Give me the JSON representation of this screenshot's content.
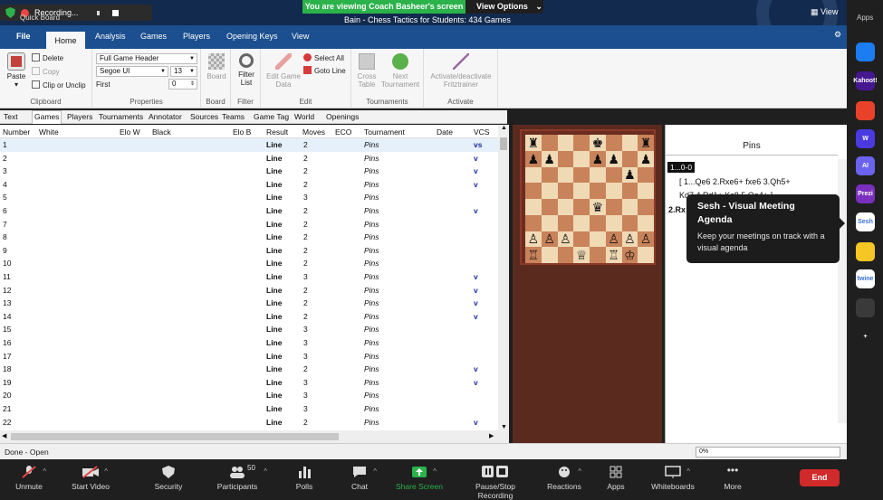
{
  "zoom_top": {
    "recording_label": "Recording...",
    "quick_board": "Quick Board",
    "viewing_text": "You are viewing Coach Basheer's screen",
    "view_options": "View Options",
    "window_title": "Bain - Chess Tactics for Students:  434 Games",
    "view_button": "View"
  },
  "menu": {
    "file": "File",
    "tabs": [
      "Home",
      "Analysis",
      "Games",
      "Players",
      "Opening Keys",
      "View"
    ]
  },
  "ribbon": {
    "paste": "Paste",
    "delete": "Delete",
    "copy": "Copy",
    "clip_or_unclip": "Clip or Unclip",
    "clipboard": "Clipboard",
    "header_select": "Full Game Header",
    "font_select": "Segoe UI",
    "font_size": "13",
    "first_label": "First",
    "first_value": "0",
    "properties": "Properties",
    "board": "Board",
    "board_group": "Board",
    "filter_list": "Filter List",
    "filter": "Filter",
    "edit_game_data": "Edit Game Data",
    "select_all": "Select All",
    "goto_line": "Goto Line",
    "edit": "Edit",
    "cross_table": "Cross Table",
    "next_tournament": "Next Tournament",
    "tournaments": "Tournaments",
    "activate_fritztrainer": "Activate/deactivate Fritztrainer",
    "activate": "Activate"
  },
  "subtabs": [
    "Text",
    "Games",
    "Players",
    "Tournaments",
    "Annotator",
    "Sources",
    "Teams",
    "Game Tag",
    "World",
    "Openings"
  ],
  "grid": {
    "headers": [
      "Number",
      "White",
      "Elo W",
      "Black",
      "Elo B",
      "Result",
      "Moves",
      "ECO",
      "Tournament",
      "Date",
      "VCS"
    ],
    "rows": [
      {
        "n": "1",
        "res": "Line",
        "mv": "2",
        "tour": "Pins",
        "vcs": "vs"
      },
      {
        "n": "2",
        "res": "Line",
        "mv": "2",
        "tour": "Pins",
        "vcs": "v"
      },
      {
        "n": "3",
        "res": "Line",
        "mv": "2",
        "tour": "Pins",
        "vcs": "v"
      },
      {
        "n": "4",
        "res": "Line",
        "mv": "2",
        "tour": "Pins",
        "vcs": "v"
      },
      {
        "n": "5",
        "res": "Line",
        "mv": "3",
        "tour": "Pins",
        "vcs": ""
      },
      {
        "n": "6",
        "res": "Line",
        "mv": "2",
        "tour": "Pins",
        "vcs": "v"
      },
      {
        "n": "7",
        "res": "Line",
        "mv": "2",
        "tour": "Pins",
        "vcs": ""
      },
      {
        "n": "8",
        "res": "Line",
        "mv": "2",
        "tour": "Pins",
        "vcs": ""
      },
      {
        "n": "9",
        "res": "Line",
        "mv": "2",
        "tour": "Pins",
        "vcs": ""
      },
      {
        "n": "10",
        "res": "Line",
        "mv": "2",
        "tour": "Pins",
        "vcs": ""
      },
      {
        "n": "11",
        "res": "Line",
        "mv": "3",
        "tour": "Pins",
        "vcs": "v"
      },
      {
        "n": "12",
        "res": "Line",
        "mv": "2",
        "tour": "Pins",
        "vcs": "v"
      },
      {
        "n": "13",
        "res": "Line",
        "mv": "2",
        "tour": "Pins",
        "vcs": "v"
      },
      {
        "n": "14",
        "res": "Line",
        "mv": "2",
        "tour": "Pins",
        "vcs": "v"
      },
      {
        "n": "15",
        "res": "Line",
        "mv": "3",
        "tour": "Pins",
        "vcs": ""
      },
      {
        "n": "16",
        "res": "Line",
        "mv": "3",
        "tour": "Pins",
        "vcs": ""
      },
      {
        "n": "17",
        "res": "Line",
        "mv": "3",
        "tour": "Pins",
        "vcs": ""
      },
      {
        "n": "18",
        "res": "Line",
        "mv": "2",
        "tour": "Pins",
        "vcs": "v"
      },
      {
        "n": "19",
        "res": "Line",
        "mv": "3",
        "tour": "Pins",
        "vcs": "v"
      },
      {
        "n": "20",
        "res": "Line",
        "mv": "3",
        "tour": "Pins",
        "vcs": ""
      },
      {
        "n": "21",
        "res": "Line",
        "mv": "3",
        "tour": "Pins",
        "vcs": ""
      },
      {
        "n": "22",
        "res": "Line",
        "mv": "2",
        "tour": "Pins",
        "vcs": "v"
      }
    ]
  },
  "status": {
    "text": "Done - Open",
    "progress": "0%"
  },
  "board": {
    "ranks": [
      [
        "♜",
        "",
        "",
        "",
        "♚",
        "",
        "",
        "♜"
      ],
      [
        "♟",
        "♟",
        "",
        "",
        "♟",
        "♟",
        "",
        "♟"
      ],
      [
        "",
        "",
        "",
        "",
        "",
        "",
        "♟",
        ""
      ],
      [
        "",
        "",
        "",
        "",
        "",
        "",
        "",
        ""
      ],
      [
        "",
        "",
        "",
        "",
        "♛",
        "",
        "",
        ""
      ],
      [
        "",
        "",
        "",
        "",
        "",
        "",
        "",
        ""
      ],
      [
        "♙",
        "♙",
        "♙",
        "",
        "",
        "♙",
        "♙",
        "♙"
      ],
      [
        "♖",
        "",
        "",
        "♕",
        "",
        "♖",
        "♔",
        ""
      ]
    ]
  },
  "notation": {
    "title": "Pins",
    "move_tag": "1...0-0",
    "line1": "[ 1...Qe6  2.Rxe6+  fxe6  3.Qh5+",
    "line2": "Kd7  4.Rd1+  Kc8  5.Qe4+ ]",
    "line3": "2.Rx"
  },
  "tooltip": {
    "title": "Sesh - Visual Meeting Agenda",
    "desc": "Keep your meetings on track with a visual agenda"
  },
  "apps": {
    "label": "Apps",
    "items": [
      {
        "name": "arrow",
        "label": "",
        "color": "#1c7cf2"
      },
      {
        "name": "kahoot",
        "label": "Kahoot!",
        "color": "#46178f"
      },
      {
        "name": "app-red",
        "label": "",
        "color": "#e8422b"
      },
      {
        "name": "w",
        "label": "W",
        "color": "#4a3ae0"
      },
      {
        "name": "ai",
        "label": "AI",
        "color": "#6b63f0"
      },
      {
        "name": "prezi",
        "label": "Prezi",
        "color": "#7b2fbe"
      },
      {
        "name": "sesh",
        "label": "Sesh",
        "color": "#ffffff"
      },
      {
        "name": "emoji",
        "label": "",
        "color": "#f6c624"
      },
      {
        "name": "twine",
        "label": "twine",
        "color": "#ffffff"
      },
      {
        "name": "grid",
        "label": "",
        "color": "#3a3a3a"
      },
      {
        "name": "add",
        "label": "+",
        "color": "#1f1f1f"
      }
    ]
  },
  "zoom_controls": {
    "unmute": "Unmute",
    "start_video": "Start Video",
    "security": "Security",
    "participants": "Participants",
    "participants_count": "50",
    "polls": "Polls",
    "chat": "Chat",
    "share_screen": "Share Screen",
    "pause_stop": "Pause/Stop Recording",
    "reactions": "Reactions",
    "apps": "Apps",
    "whiteboards": "Whiteboards",
    "more": "More",
    "end": "End"
  }
}
